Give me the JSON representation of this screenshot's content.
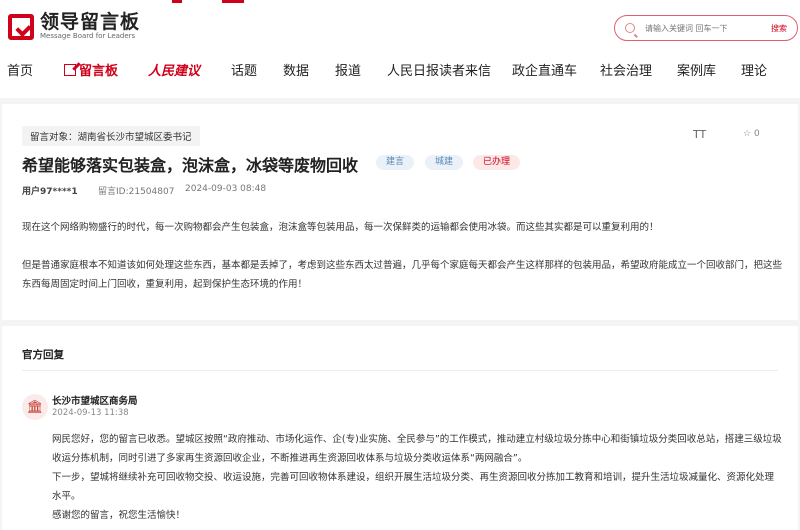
{
  "brand": {
    "name_cn": "领导留言板",
    "name_en": "Message Board for Leaders",
    "accent": "#d0021b"
  },
  "search": {
    "placeholder": "请输入关键词 回车一下",
    "button": "搜索"
  },
  "nav": [
    {
      "label": "首页"
    },
    {
      "label": "留言板"
    },
    {
      "label": "人民建议"
    },
    {
      "label": "话题"
    },
    {
      "label": "数据"
    },
    {
      "label": "报道"
    },
    {
      "label": "人民日报读者来信"
    },
    {
      "label": "政企直通车"
    },
    {
      "label": "社会治理"
    },
    {
      "label": "案例库"
    },
    {
      "label": "理论"
    }
  ],
  "message": {
    "target": "留言对象：湖南省长沙市望城区委书记",
    "font_icon": "TT",
    "fav_count": "0",
    "title": "希望能够落实包装盒，泡沫盒，冰袋等废物回收",
    "tags": [
      "建言",
      "城建",
      "已办理"
    ],
    "user": "用户97****1",
    "id": "留言ID:21504807",
    "date": "2024-09-03 08:48",
    "body": [
      "现在这个网络购物盛行的时代，每一次购物都会产生包装盒，泡沫盒等包装用品，每一次保鲜类的运输都会使用冰袋。而这些其实都是可以重复利用的！",
      "但是普通家庭根本不知道该如何处理这些东西，基本都是丢掉了，考虑到这些东西太过普遍，几乎每个家庭每天都会产生这样那样的包装用品，希望政府能成立一个回收部门，把这些东西每周固定时间上门回收，重复利用，起到保护生态环境的作用！"
    ]
  },
  "reply": {
    "heading": "官方回复",
    "org": "长沙市望城区商务局",
    "time": "2024-09-13 11:38",
    "body": [
      "网民您好，您的留言已收悉。望城区按照“政府推动、市场化运作、企(专)业实施、全民参与”的工作模式，推动建立村级垃圾分拣中心和街镇垃圾分类回收总站，搭建三级垃圾收运分拣机制，同时引进了多家再生资源回收企业，不断推进再生资源回收体系与垃圾分类收运体系“两网融合”。",
      "下一步，望城将继续补充可回收物交投、收运设施，完善可回收物体系建设，组织开展生活垃圾分类、再生资源回收分拣加工教育和培训，提升生活垃圾减量化、资源化处理水平。",
      "感谢您的留言，祝您生活愉快！"
    ]
  }
}
